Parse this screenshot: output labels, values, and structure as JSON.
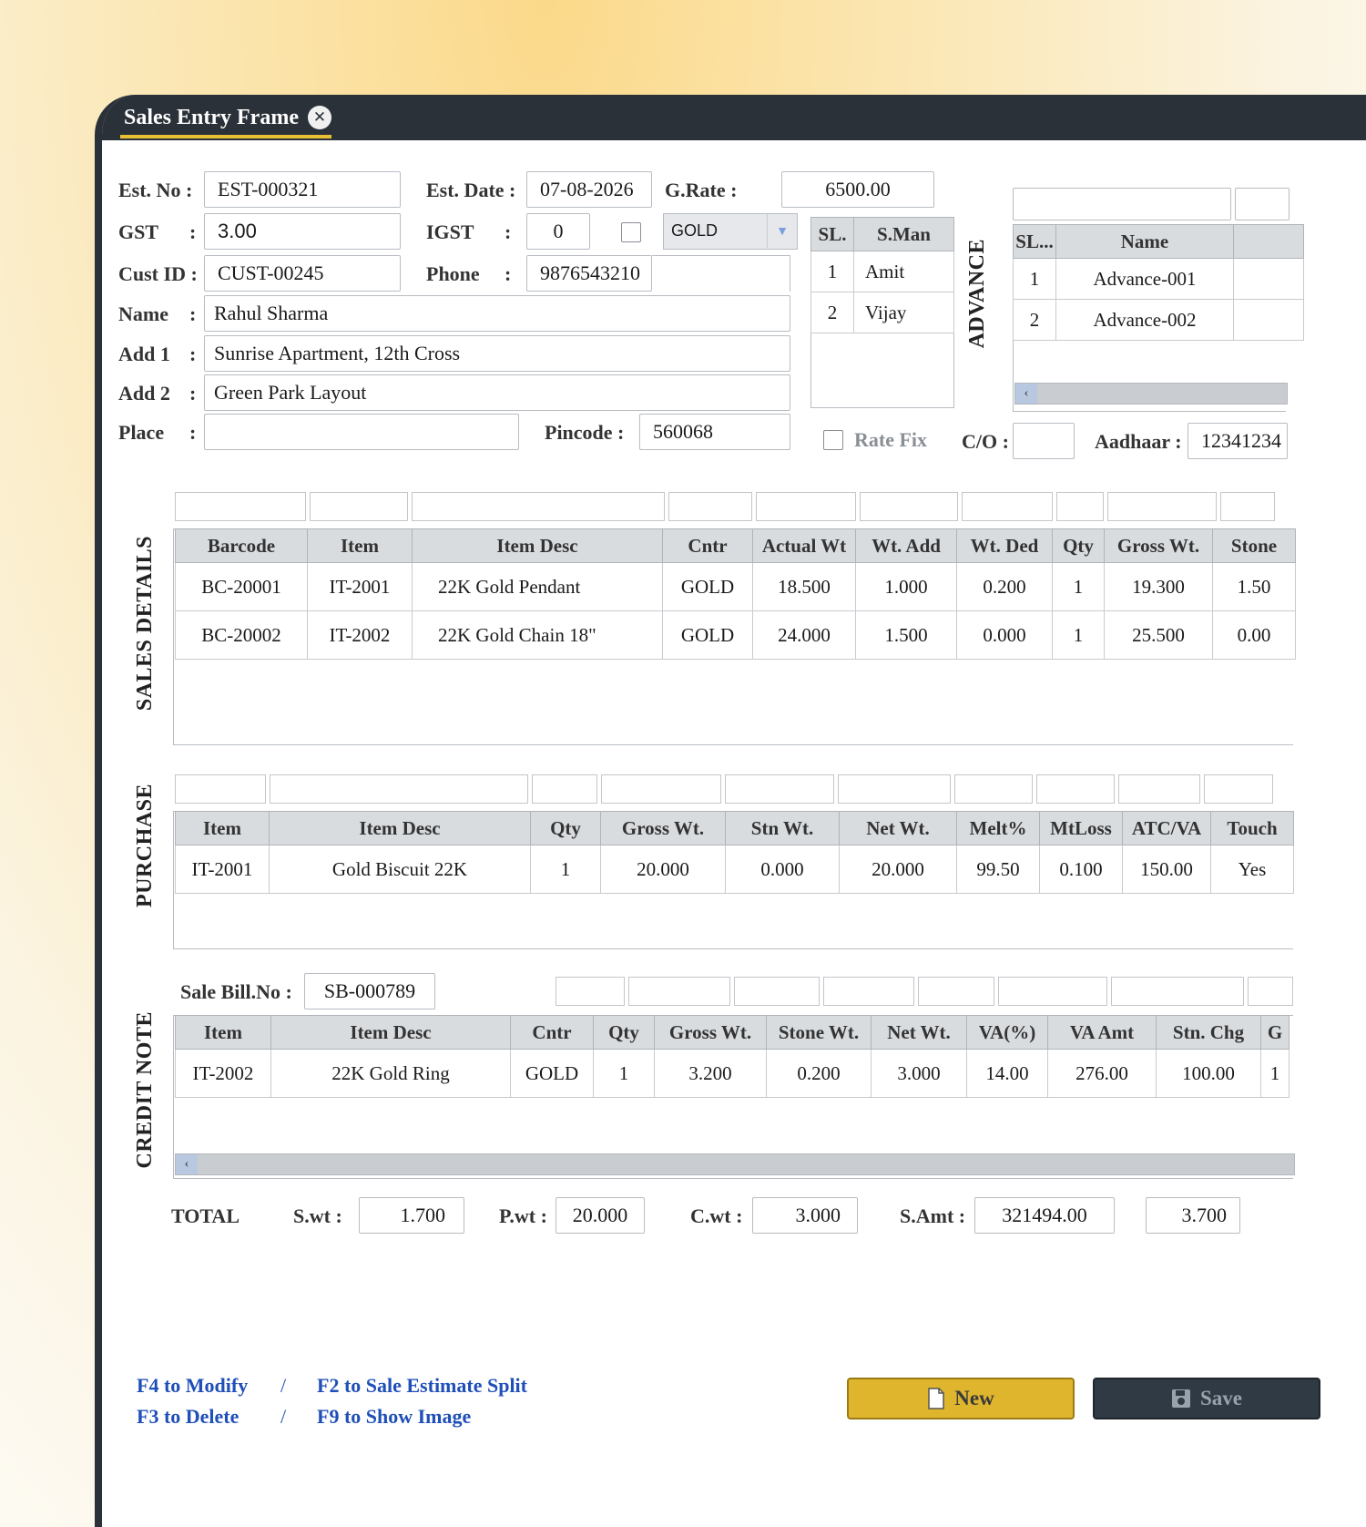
{
  "window": {
    "title": "Sales Entry Frame"
  },
  "header": {
    "est_no_label": "Est. No :",
    "est_no": "EST-000321",
    "est_date_label": "Est. Date :",
    "est_date": "07-08-2026",
    "grate_label": "G.Rate  :",
    "grate": "6500.00",
    "gst_label": "GST",
    "gst": "3.00",
    "igst_label": "IGST",
    "igst": "0",
    "metal": "GOLD",
    "cust_id_label": "Cust ID :",
    "cust_id": "CUST-00245",
    "phone_label": "Phone",
    "phone": "9876543210",
    "name_label": "Name",
    "name": "Rahul Sharma",
    "add1_label": "Add 1",
    "add1": "Sunrise Apartment, 12th Cross",
    "add2_label": "Add 2",
    "add2": "Green Park Layout",
    "place_label": "Place",
    "place": "",
    "pincode_label": "Pincode :",
    "pincode": "560068",
    "rate_fix_label": "Rate Fix",
    "co_label": "C/O :",
    "co": "",
    "aadhaar_label": "Aadhaar :",
    "aadhaar": "12341234"
  },
  "salesman": {
    "columns": [
      "SL.",
      "S.Man"
    ],
    "rows": [
      [
        "1",
        "Amit"
      ],
      [
        "2",
        "Vijay"
      ]
    ]
  },
  "advance": {
    "title": "ADVANCE",
    "columns": [
      "SL...",
      "Name"
    ],
    "rows": [
      [
        "1",
        "Advance-001"
      ],
      [
        "2",
        "Advance-002"
      ]
    ]
  },
  "sales": {
    "title": "SALES DETAILS",
    "columns": [
      "Barcode",
      "Item",
      "Item Desc",
      "Cntr",
      "Actual Wt",
      "Wt. Add",
      "Wt. Ded",
      "Qty",
      "Gross Wt.",
      "Stone"
    ],
    "rows": [
      [
        "BC-20001",
        "IT-2001",
        "22K Gold Pendant",
        "GOLD",
        "18.500",
        "1.000",
        "0.200",
        "1",
        "19.300",
        "1.50"
      ],
      [
        "BC-20002",
        "IT-2002",
        "22K Gold Chain 18\"",
        "GOLD",
        "24.000",
        "1.500",
        "0.000",
        "1",
        "25.500",
        "0.00"
      ]
    ]
  },
  "purchase": {
    "title": "PURCHASE",
    "columns": [
      "Item",
      "Item Desc",
      "Qty",
      "Gross Wt.",
      "Stn Wt.",
      "Net Wt.",
      "Melt%",
      "MtLoss",
      "ATC/VA",
      "Touch"
    ],
    "rows": [
      [
        "IT-2001",
        "Gold Biscuit 22K",
        "1",
        "20.000",
        "0.000",
        "20.000",
        "99.50",
        "0.100",
        "150.00",
        "Yes"
      ]
    ]
  },
  "credit_note": {
    "title": "CREDIT NOTE",
    "sale_bill_label": "Sale Bill.No :",
    "sale_bill": "SB-000789",
    "columns": [
      "Item",
      "Item Desc",
      "Cntr",
      "Qty",
      "Gross Wt.",
      "Stone Wt.",
      "Net Wt.",
      "VA(%)",
      "VA Amt",
      "Stn. Chg",
      "G"
    ],
    "rows": [
      [
        "IT-2002",
        "22K Gold Ring",
        "GOLD",
        "1",
        "3.200",
        "0.200",
        "3.000",
        "14.00",
        "276.00",
        "100.00",
        "1"
      ]
    ]
  },
  "totals": {
    "label": "TOTAL",
    "swt_label": "S.wt :",
    "swt": "1.700",
    "pwt_label": "P.wt :",
    "pwt": "20.000",
    "cwt_label": "C.wt :",
    "cwt": "3.000",
    "samt_label": "S.Amt :",
    "samt": "321494.00",
    "extra": "3.700"
  },
  "hints": {
    "modify": "F4 to Modify",
    "split": "F2 to Sale Estimate Split",
    "delete": "F3 to Delete",
    "image": "F9 to Show Image",
    "sep": "/"
  },
  "buttons": {
    "new": "New",
    "save": "Save"
  },
  "icons": {
    "close": "close-icon",
    "new": "document-icon",
    "save": "floppy-icon",
    "dropdown": "chevron-down-icon",
    "scroll_left": "chevron-left-icon"
  },
  "colors": {
    "titlebar": "#2a3138",
    "accent": "#e8c034",
    "new_button": "#e0b52e",
    "hint_text": "#1f4fb8"
  }
}
